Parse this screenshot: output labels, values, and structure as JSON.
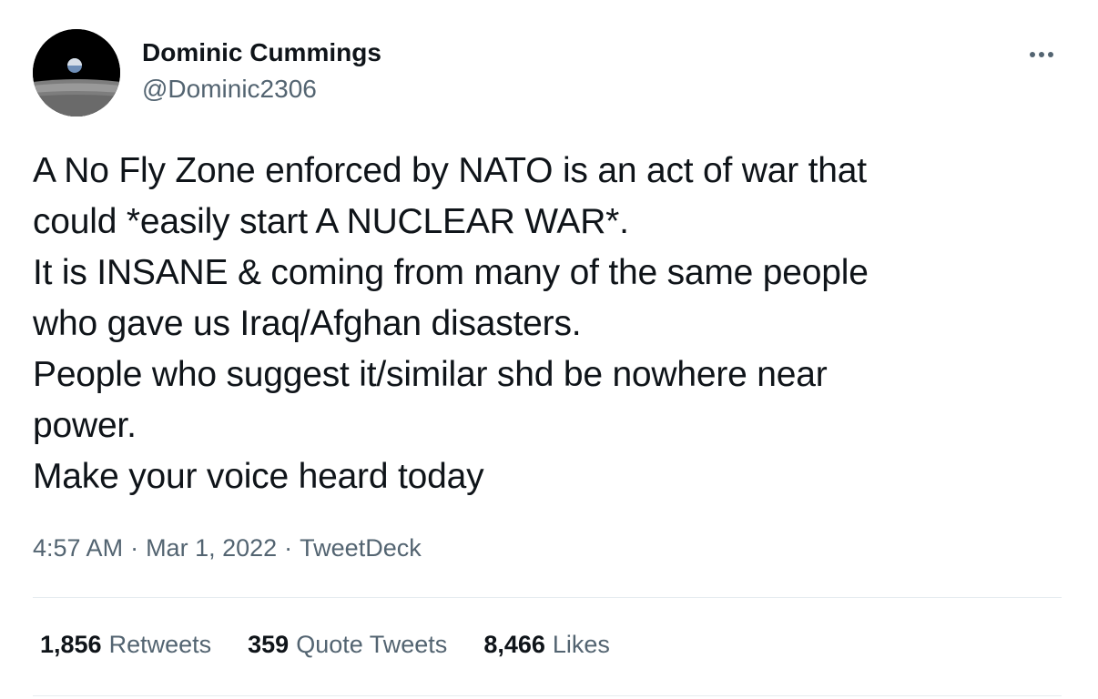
{
  "user": {
    "display_name": "Dominic Cummings",
    "handle": "@Dominic2306",
    "avatar_icon": "earthrise-avatar"
  },
  "tweet": {
    "text": "A No Fly Zone enforced by NATO is an act of war that\ncould *easily start A NUCLEAR WAR*.\nIt is INSANE & coming from many of the same people\nwho gave us Iraq/Afghan disasters.\nPeople who suggest it/similar shd be nowhere near\npower.\nMake your voice heard today",
    "time": "4:57 AM",
    "date": "Mar 1, 2022",
    "source": "TweetDeck",
    "separator": "·"
  },
  "stats": {
    "retweets": {
      "count": "1,856",
      "label": "Retweets"
    },
    "quotes": {
      "count": "359",
      "label": "Quote Tweets"
    },
    "likes": {
      "count": "8,466",
      "label": "Likes"
    }
  },
  "menu": {
    "icon": "more-dots-icon"
  },
  "colors": {
    "text": "#0f1419",
    "secondary": "#536471",
    "divider": "#e6ecf0"
  }
}
